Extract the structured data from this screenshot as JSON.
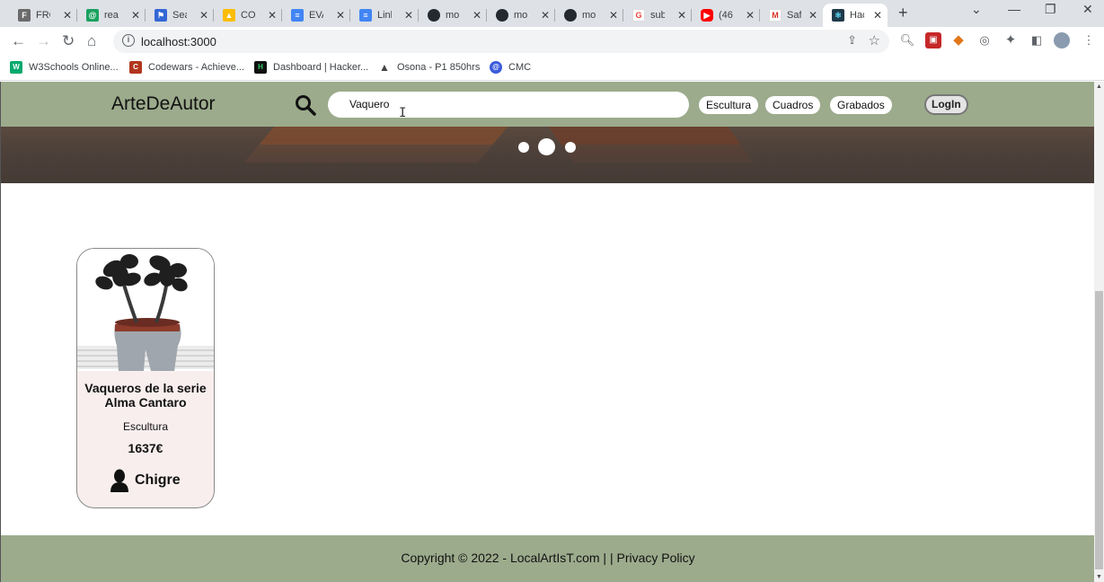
{
  "browser": {
    "tabs": [
      {
        "label": "FRC",
        "color": "#4a4a4a",
        "glyph": "F"
      },
      {
        "label": "rea",
        "color": "#1aa260",
        "glyph": "@"
      },
      {
        "label": "Sea",
        "color": "#3367d6",
        "glyph": "⚑"
      },
      {
        "label": "COI",
        "color": "#fbbc04",
        "glyph": "▲"
      },
      {
        "label": "EVA",
        "color": "#4285f4",
        "glyph": "≡"
      },
      {
        "label": "Link",
        "color": "#4285f4",
        "glyph": "≡"
      },
      {
        "label": "mo",
        "color": "#24292f",
        "glyph": "●"
      },
      {
        "label": "mo",
        "color": "#24292f",
        "glyph": "●"
      },
      {
        "label": "mo",
        "color": "#24292f",
        "glyph": "●"
      },
      {
        "label": "sub",
        "color": "#ea4335",
        "glyph": "G"
      },
      {
        "label": "(46",
        "color": "#ff0000",
        "glyph": "▶"
      },
      {
        "label": "Saf",
        "color": "#d93025",
        "glyph": "M"
      },
      {
        "label": "Hac",
        "color": "#1e3a4a",
        "glyph": "⚛"
      }
    ],
    "tab_close_glyph": "✕",
    "new_tab_glyph": "+",
    "window_controls": {
      "menu": "⌄",
      "minimize": "—",
      "restore": "❐",
      "close": "✕"
    },
    "url": "localhost:3000",
    "bookmarks": [
      {
        "label": "W3Schools Online...",
        "color": "#04aa6d",
        "glyph": "W"
      },
      {
        "label": "Codewars - Achieve...",
        "color": "#b1361e",
        "glyph": "C"
      },
      {
        "label": "Dashboard | Hacker...",
        "color": "#111111",
        "glyph": "H"
      },
      {
        "label": "Osona - P1 850hrs",
        "color": "#555555",
        "glyph": "▲"
      },
      {
        "label": "CMC",
        "color": "#3b5bdb",
        "glyph": "@"
      }
    ]
  },
  "site": {
    "brand": "ArteDeAutor",
    "search_value": "Vaquero",
    "categories": [
      "Escultura",
      "Cuadros",
      "Grabados"
    ],
    "login": "LogIn",
    "carousel_dots": 3,
    "carousel_active": 2
  },
  "products": [
    {
      "title": "Vaqueros de la serie Alma Cantaro",
      "category": "Escultura",
      "price": "1637€",
      "author": "Chigre"
    }
  ],
  "footer": {
    "copyright": "Copyright © 2022 - LocalArtIsT.com | | Privacy Policy"
  }
}
